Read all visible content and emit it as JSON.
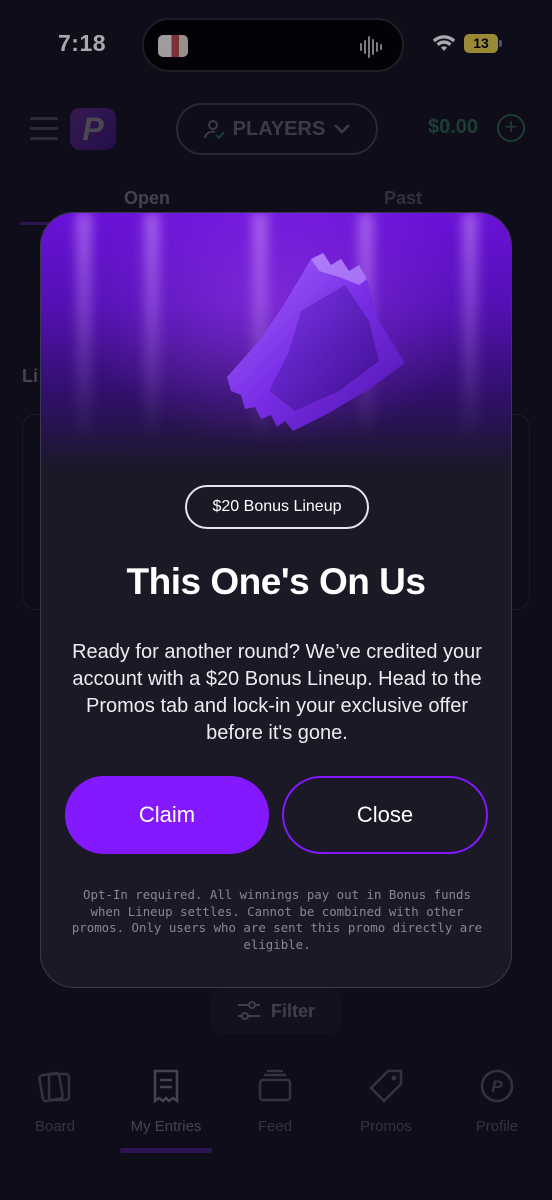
{
  "status_bar": {
    "time": "7:18",
    "battery": "13"
  },
  "header": {
    "selector_label": "PLAYERS",
    "balance": "$0.00"
  },
  "tabs": [
    {
      "label": "Open"
    },
    {
      "label": "Past"
    }
  ],
  "lineups_heading": "Li",
  "filter_label": "Filter",
  "bottom_nav": [
    {
      "label": "Board",
      "icon": "board-icon"
    },
    {
      "label": "My Entries",
      "icon": "entries-icon",
      "active": true
    },
    {
      "label": "Feed",
      "icon": "feed-icon"
    },
    {
      "label": "Promos",
      "icon": "promos-icon"
    },
    {
      "label": "Profile",
      "icon": "profile-icon"
    }
  ],
  "modal": {
    "chip": "$20 Bonus Lineup",
    "title": "This One's On Us",
    "body": "Ready for another round? We’ve credited your account with a $20 Bonus Lineup. Head to the Promos tab and lock-in your exclusive offer before it's gone.",
    "claim_label": "Claim",
    "close_label": "Close",
    "disclaimer": "Opt-In required. All winnings pay out in Bonus funds when Lineup settles. Cannot be combined with other promos. Only users who are sent this promo directly are eligible."
  },
  "colors": {
    "accent": "#8419ff",
    "background": "#13111f",
    "balance": "#4fd18b"
  }
}
